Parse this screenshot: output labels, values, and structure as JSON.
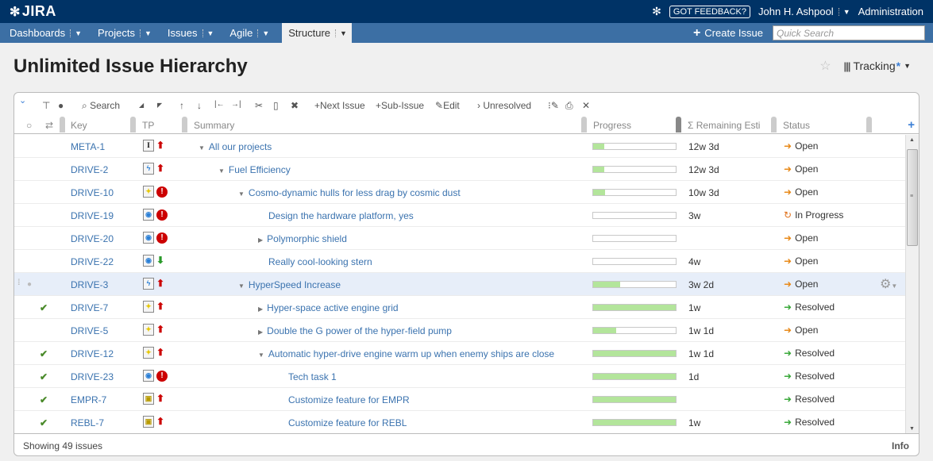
{
  "app": {
    "logo": "JIRA"
  },
  "header": {
    "feedback_label": "GOT FEEDBACK?",
    "user_name": "John H. Ashpool",
    "admin_label": "Administration"
  },
  "nav": {
    "items": [
      {
        "label": "Dashboards"
      },
      {
        "label": "Projects"
      },
      {
        "label": "Issues"
      },
      {
        "label": "Agile"
      },
      {
        "label": "Structure"
      }
    ],
    "create_label": "Create Issue",
    "search_placeholder": "Quick Search"
  },
  "page": {
    "title": "Unlimited Issue Hierarchy",
    "view_label": "Tracking",
    "view_modified_mark": "*"
  },
  "toolbar": {
    "search_label": "Search",
    "next_issue_label": "Next Issue",
    "sub_issue_label": "Sub-Issue",
    "edit_label": "Edit",
    "unresolved_label": "Unresolved"
  },
  "columns": {
    "key": "Key",
    "tp": "TP",
    "summary": "Summary",
    "progress": "Progress",
    "remaining": "Σ Remaining Esti",
    "status": "Status"
  },
  "rows": [
    {
      "key": "META-1",
      "type": "meta",
      "priority": "up",
      "summary": "All our projects",
      "depth": 0,
      "toggle": "expanded",
      "progress": 13,
      "remaining": "12w 3d",
      "status": "Open",
      "resolved_check": false
    },
    {
      "key": "DRIVE-2",
      "type": "story",
      "priority": "up",
      "summary": "Fuel Efficiency",
      "depth": 1,
      "toggle": "expanded",
      "progress": 13,
      "remaining": "12w 3d",
      "status": "Open",
      "resolved_check": false
    },
    {
      "key": "DRIVE-10",
      "type": "idea",
      "priority": "blocker",
      "summary": "Cosmo-dynamic hulls for less drag by cosmic dust",
      "depth": 2,
      "toggle": "expanded",
      "progress": 14,
      "remaining": "10w 3d",
      "status": "Open",
      "resolved_check": false
    },
    {
      "key": "DRIVE-19",
      "type": "task",
      "priority": "blocker",
      "summary": "Design the hardware platform, yes",
      "depth": 3,
      "toggle": "none",
      "progress": 0,
      "remaining": "3w",
      "status": "In Progress",
      "resolved_check": false
    },
    {
      "key": "DRIVE-20",
      "type": "task",
      "priority": "blocker",
      "summary": "Polymorphic shield",
      "depth": 3,
      "toggle": "collapsed",
      "progress": 0,
      "remaining": "",
      "status": "Open",
      "resolved_check": false
    },
    {
      "key": "DRIVE-22",
      "type": "task",
      "priority": "down",
      "summary": "Really cool-looking stern",
      "depth": 3,
      "toggle": "none",
      "progress": 0,
      "remaining": "4w",
      "status": "Open",
      "resolved_check": false
    },
    {
      "key": "DRIVE-3",
      "type": "story",
      "priority": "up",
      "summary": "HyperSpeed Increase",
      "depth": 2,
      "toggle": "expanded",
      "progress": 33,
      "remaining": "3w 2d",
      "status": "Open",
      "resolved_check": false,
      "selected": true
    },
    {
      "key": "DRIVE-7",
      "type": "idea",
      "priority": "up",
      "summary": "Hyper-space active engine grid",
      "depth": 3,
      "toggle": "collapsed",
      "progress": 100,
      "remaining": "1w",
      "status": "Resolved",
      "resolved_check": true
    },
    {
      "key": "DRIVE-5",
      "type": "idea",
      "priority": "up",
      "summary": "Double the G power of the hyper-field pump",
      "depth": 3,
      "toggle": "collapsed",
      "progress": 28,
      "remaining": "1w 1d",
      "status": "Open",
      "resolved_check": false
    },
    {
      "key": "DRIVE-12",
      "type": "idea",
      "priority": "up",
      "summary": "Automatic hyper-drive engine warm up when enemy ships are close",
      "depth": 3,
      "toggle": "expanded",
      "progress": 100,
      "remaining": "1w 1d",
      "status": "Resolved",
      "resolved_check": true
    },
    {
      "key": "DRIVE-23",
      "type": "task",
      "priority": "blocker",
      "summary": "Tech task 1",
      "depth": 4,
      "toggle": "none",
      "progress": 100,
      "remaining": "1d",
      "status": "Resolved",
      "resolved_check": true
    },
    {
      "key": "EMPR-7",
      "type": "feat",
      "priority": "up",
      "summary": "Customize feature for EMPR",
      "depth": 4,
      "toggle": "none",
      "progress": 100,
      "remaining": "",
      "status": "Resolved",
      "resolved_check": true
    },
    {
      "key": "REBL-7",
      "type": "feat",
      "priority": "up",
      "summary": "Customize feature for REBL",
      "depth": 4,
      "toggle": "none",
      "progress": 100,
      "remaining": "1w",
      "status": "Resolved",
      "resolved_check": true
    }
  ],
  "footer": {
    "count_label": "Showing 49 issues",
    "info_label": "Info"
  },
  "colors": {
    "topbar": "#003366",
    "navbar": "#3c6fa4",
    "link": "#3b73af",
    "progress_fill": "#b3e59b"
  }
}
